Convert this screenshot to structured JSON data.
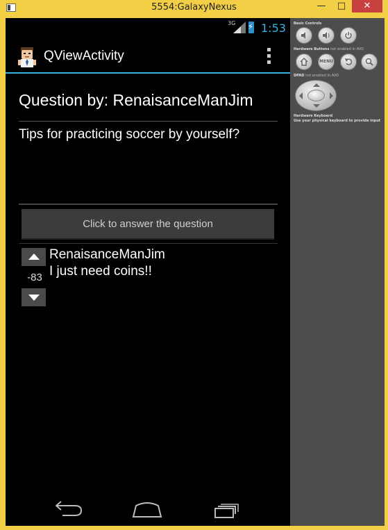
{
  "window": {
    "title": "5554:GalaxyNexus",
    "minimize_label": "—",
    "maximize_label": "□",
    "close_label": "✕"
  },
  "statusbar": {
    "network": "3G",
    "time": "1:53",
    "accent_color": "#33b5e5"
  },
  "actionbar": {
    "title": "QViewActivity",
    "overflow_icon": "overflow-menu-icon"
  },
  "question": {
    "by_label": "Question by: RenaisanceManJim",
    "text": "Tips for practicing soccer by yourself?"
  },
  "answer_button": {
    "label": "Click to answer the question"
  },
  "answers": [
    {
      "user": "RenaisanceManJim",
      "text": "I just need coins!!",
      "score": "-83"
    }
  ],
  "navbar": {
    "back_icon": "back-icon",
    "home_icon": "home-icon",
    "recents_icon": "recents-icon"
  },
  "controls_panel": {
    "basic_controls_label": "Basic Controls",
    "hardware_buttons_label": "Hardware Buttons",
    "hardware_buttons_note": "not enabled in AVD",
    "dpad_label": "DPAD",
    "dpad_note": "not enabled in AVD",
    "keyboard_label": "Hardware Keyboard",
    "keyboard_note": "Use your physical keyboard to provide input",
    "menu_label": "MENU"
  }
}
